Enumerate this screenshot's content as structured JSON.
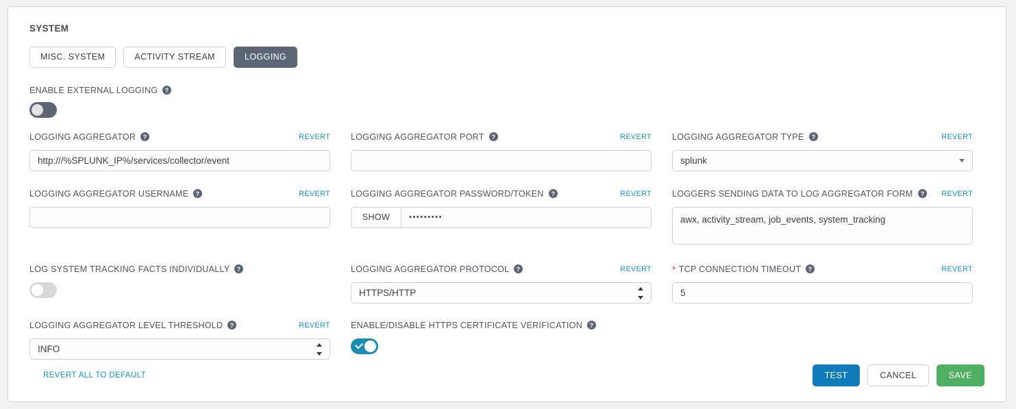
{
  "section": {
    "title": "SYSTEM"
  },
  "tabs": [
    {
      "label": "MISC. SYSTEM",
      "active": false
    },
    {
      "label": "ACTIVITY STREAM",
      "active": false
    },
    {
      "label": "LOGGING",
      "active": true
    }
  ],
  "revert_label": "REVERT",
  "fields": {
    "enable_external_logging": {
      "label": "ENABLE EXTERNAL LOGGING",
      "toggle_state": "off"
    },
    "logging_aggregator": {
      "label": "LOGGING AGGREGATOR",
      "value": "http:///%SPLUNK_IP%/services/collector/event",
      "placeholder": ""
    },
    "logging_aggregator_port": {
      "label": "LOGGING AGGREGATOR PORT",
      "value": "",
      "placeholder": ""
    },
    "logging_aggregator_type": {
      "label": "LOGGING AGGREGATOR TYPE",
      "value": "splunk"
    },
    "logging_aggregator_username": {
      "label": "LOGGING AGGREGATOR USERNAME",
      "value": "",
      "placeholder": ""
    },
    "logging_aggregator_password": {
      "label": "LOGGING AGGREGATOR PASSWORD/TOKEN",
      "show_label": "SHOW",
      "masked_value": "•••••••••"
    },
    "loggers_sending_data": {
      "label": "LOGGERS SENDING DATA TO LOG AGGREGATOR FORM",
      "value": "awx, activity_stream, job_events, system_tracking"
    },
    "log_system_tracking_facts": {
      "label": "LOG SYSTEM TRACKING FACTS INDIVIDUALLY",
      "toggle_state": "off"
    },
    "logging_aggregator_protocol": {
      "label": "LOGGING AGGREGATOR PROTOCOL",
      "value": "HTTPS/HTTP"
    },
    "tcp_connection_timeout": {
      "label": "TCP CONNECTION TIMEOUT",
      "required_marker": "*",
      "value": "5"
    },
    "logging_aggregator_level_threshold": {
      "label": "LOGGING AGGREGATOR LEVEL THRESHOLD",
      "value": "INFO"
    },
    "https_certificate_verification": {
      "label": "ENABLE/DISABLE HTTPS CERTIFICATE VERIFICATION",
      "toggle_state": "on"
    }
  },
  "footer": {
    "revert_all_label": "REVERT ALL TO DEFAULT",
    "test_label": "TEST",
    "cancel_label": "CANCEL",
    "save_label": "SAVE"
  },
  "colors": {
    "accent_link": "#1a8fcb",
    "tab_active_bg": "#5b6573",
    "toggle_on": "#1a8cb0",
    "test_button": "#0f7bba",
    "save_button": "#4fb061",
    "required_star": "#d9534f"
  }
}
